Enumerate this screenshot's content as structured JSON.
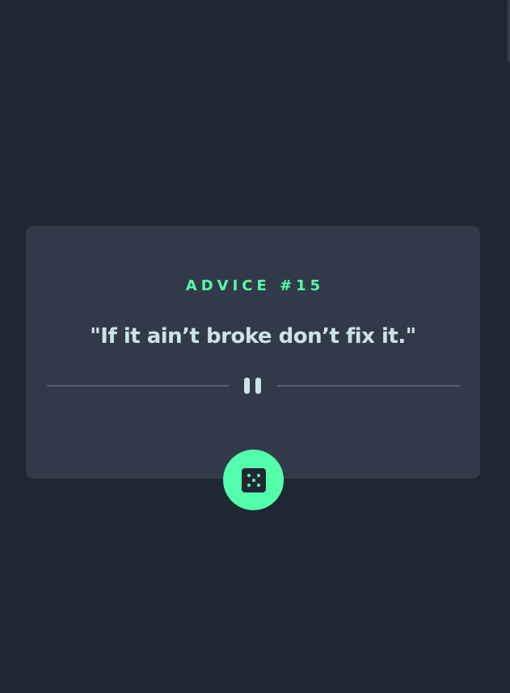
{
  "advice": {
    "label": "ADVICE #15",
    "quote": "\"If it ain’t broke don’t fix it.\""
  },
  "icons": {
    "divider": "pause-icon",
    "generate": "dice-icon"
  },
  "colors": {
    "background": "#1f2632",
    "card": "#323a49",
    "accent": "#53ffaa",
    "text": "#cee3e9",
    "divider": "#4f5d74"
  }
}
